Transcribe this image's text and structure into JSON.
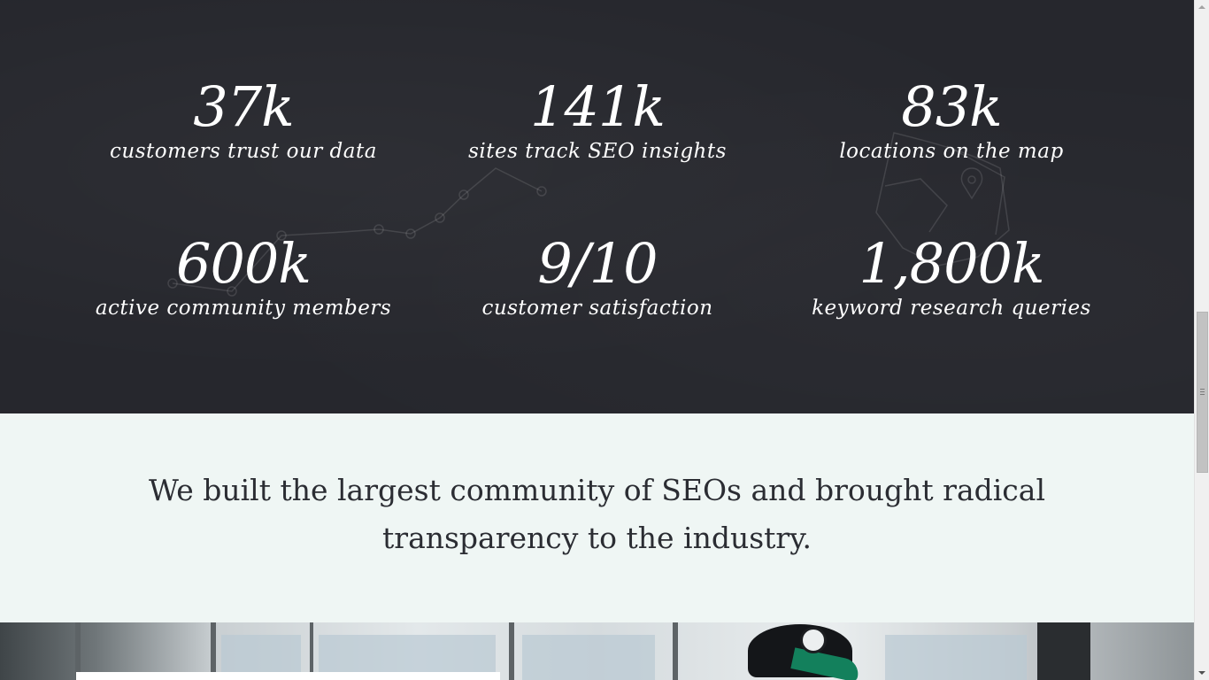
{
  "stats": [
    {
      "value": "37k",
      "label": "customers trust our data"
    },
    {
      "value": "141k",
      "label": "sites track SEO insights"
    },
    {
      "value": "83k",
      "label": "locations on the map"
    },
    {
      "value": "600k",
      "label": "active community members"
    },
    {
      "value": "9/10",
      "label": "customer satisfaction"
    },
    {
      "value": "1,800k",
      "label": "keyword research queries"
    }
  ],
  "mission": {
    "text": "We built the largest community of SEOs and brought radical transparency to the industry."
  },
  "colors": {
    "chalkboard": "#26272d",
    "mission_bg": "#eff6f4",
    "mission_text": "#2b2d33",
    "cap_bill": "#13805c"
  },
  "icons": {
    "scroll_up": "chevron-up-icon",
    "scroll_down": "chevron-down-icon"
  }
}
